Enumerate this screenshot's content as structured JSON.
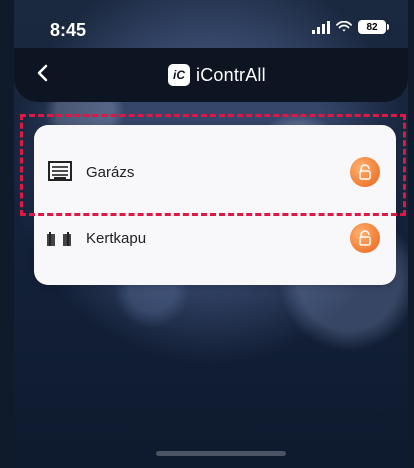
{
  "status_bar": {
    "time": "8:45",
    "battery": "82"
  },
  "navbar": {
    "back_icon": "chevron-left-icon",
    "logo_mark": "iC",
    "title": "iContrAll"
  },
  "devices": [
    {
      "label": "Garázs",
      "icon": "garage-door-icon",
      "action_icon": "unlock-icon",
      "action_color": "#f07a32"
    },
    {
      "label": "Kertkapu",
      "icon": "gate-icon",
      "action_icon": "unlock-icon",
      "action_color": "#f07a32"
    }
  ],
  "highlight_color": "#dd1845"
}
